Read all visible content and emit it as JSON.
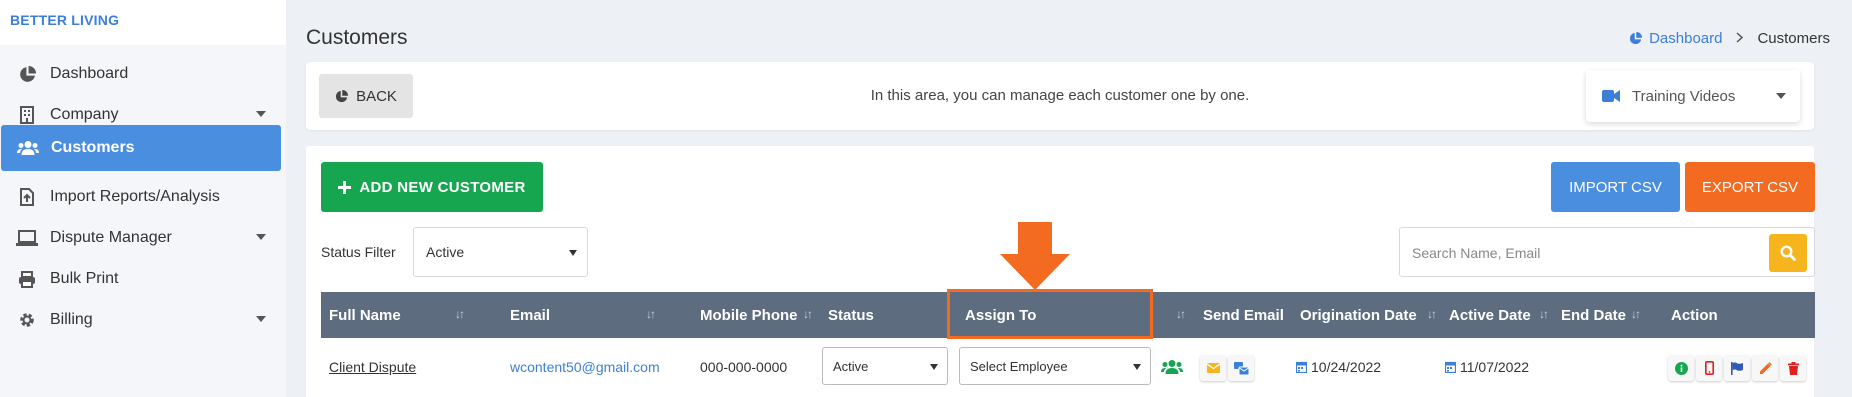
{
  "brand": "BETTER LIVING",
  "sidebar": {
    "items": [
      {
        "label": "Dashboard",
        "icon": "pie-chart-icon"
      },
      {
        "label": "Company",
        "icon": "building-icon"
      },
      {
        "label": "Customers",
        "icon": "users-icon",
        "active": true
      },
      {
        "label": "Import Reports/Analysis",
        "icon": "file-import-icon"
      },
      {
        "label": "Dispute Manager",
        "icon": "laptop-icon"
      },
      {
        "label": "Bulk Print",
        "icon": "printer-icon"
      },
      {
        "label": "Billing",
        "icon": "cog-icon"
      }
    ]
  },
  "header": {
    "title": "Customers",
    "breadcrumb": {
      "home": "Dashboard",
      "current": "Customers"
    }
  },
  "toolbar": {
    "back_label": "BACK",
    "info_text": "In this area, you can manage each customer one by one.",
    "training_label": "Training Videos"
  },
  "actions": {
    "add_label": "ADD NEW CUSTOMER",
    "import_label": "IMPORT CSV",
    "export_label": "EXPORT CSV"
  },
  "filter": {
    "label": "Status Filter",
    "value": "Active"
  },
  "search": {
    "placeholder": "Search Name, Email"
  },
  "table": {
    "columns": [
      "Full Name",
      "Email",
      "Mobile Phone",
      "Status",
      "Assign To",
      "Send Email",
      "Origination Date",
      "Active Date",
      "End Date",
      "Action"
    ],
    "rows": [
      {
        "full_name": "Client Dispute",
        "email": "wcontent50@gmail.com",
        "mobile_phone": "000-000-0000",
        "status": "Active",
        "assign_to": "Select Employee",
        "origination_date": "10/24/2022",
        "active_date": "11/07/2022",
        "end_date": ""
      }
    ]
  },
  "colors": {
    "accent_blue": "#4a8ee0",
    "green": "#17a650",
    "orange": "#f26b21",
    "yellow": "#f6b51c",
    "table_header": "#5d6c7e"
  }
}
